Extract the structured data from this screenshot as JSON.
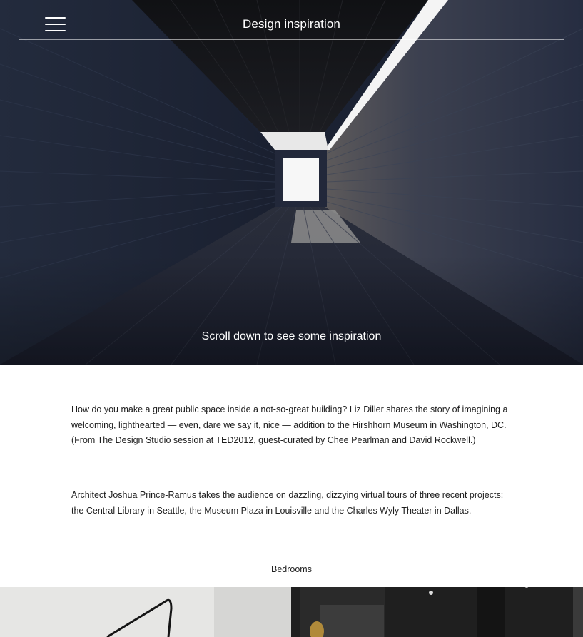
{
  "header": {
    "title": "Design inspiration",
    "menu_icon": "hamburger-menu-icon"
  },
  "hero": {
    "caption": "Scroll down to see some inspiration",
    "colors": {
      "wall_dark": "#1b2233",
      "ceiling": "#141414",
      "light": "#f2f2f2"
    }
  },
  "main": {
    "paragraphs": [
      "How do you make a great public space inside a not-so-great building? Liz Diller shares the story of imagining a welcoming, lighthearted — even, dare we say it, nice — addition to the Hirshhorn Museum in Washington, DC. (From The Design Studio session at TED2012, guest-curated by Chee Pearlman and David Rockwell.)",
      "Architect Joshua Prince-Ramus takes the audience on dazzling, dizzying virtual tours of three recent projects: the Central Library in Seattle, the Museum Plaza in Louisville and the Charles Wyly Theater in Dallas."
    ]
  },
  "gallery": {
    "label": "Bedrooms"
  }
}
